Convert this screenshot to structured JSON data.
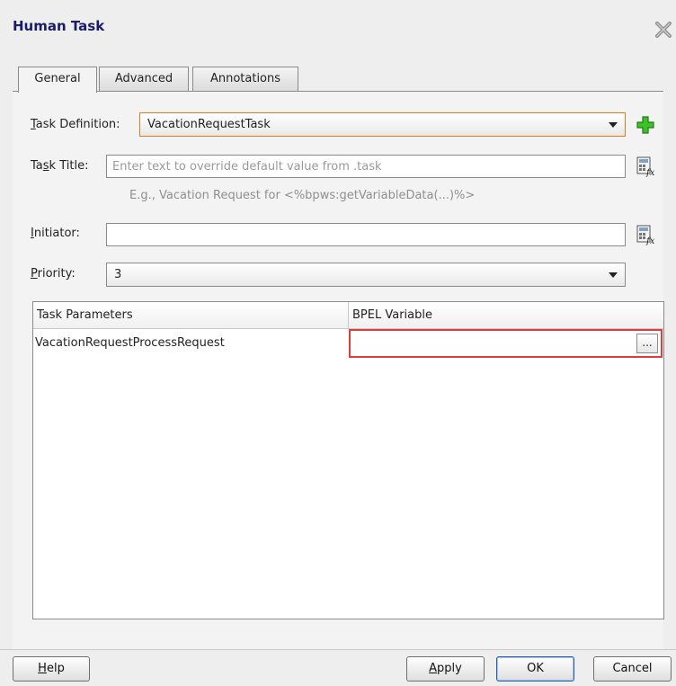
{
  "dialog": {
    "title": "Human Task"
  },
  "tabs": [
    {
      "label": "General",
      "active": true
    },
    {
      "label": "Advanced",
      "active": false
    },
    {
      "label": "Annotations",
      "active": false
    }
  ],
  "form": {
    "task_definition": {
      "label_first": "T",
      "label_rest": "ask Definition:",
      "value": "VacationRequestTask"
    },
    "task_title": {
      "label_first": "Ta",
      "label_u": "s",
      "label_rest": "k Title:",
      "value": "",
      "placeholder": "Enter text to override default value from .task",
      "hint": "E.g., Vacation Request for <%bpws:getVariableData(...)%>"
    },
    "initiator": {
      "label_u": "I",
      "label_rest": "nitiator:",
      "value": ""
    },
    "priority": {
      "label_u": "P",
      "label_rest": "riority:",
      "value": "3"
    }
  },
  "table": {
    "columns": [
      "Task Parameters",
      "BPEL Variable"
    ],
    "rows": [
      {
        "parameter": "VacationRequestProcessRequest",
        "variable": ""
      }
    ],
    "browse_label": "..."
  },
  "buttons": {
    "help_u": "H",
    "help_rest": "elp",
    "apply_u": "A",
    "apply_rest": "pply",
    "ok": "OK",
    "cancel": "Cancel"
  }
}
